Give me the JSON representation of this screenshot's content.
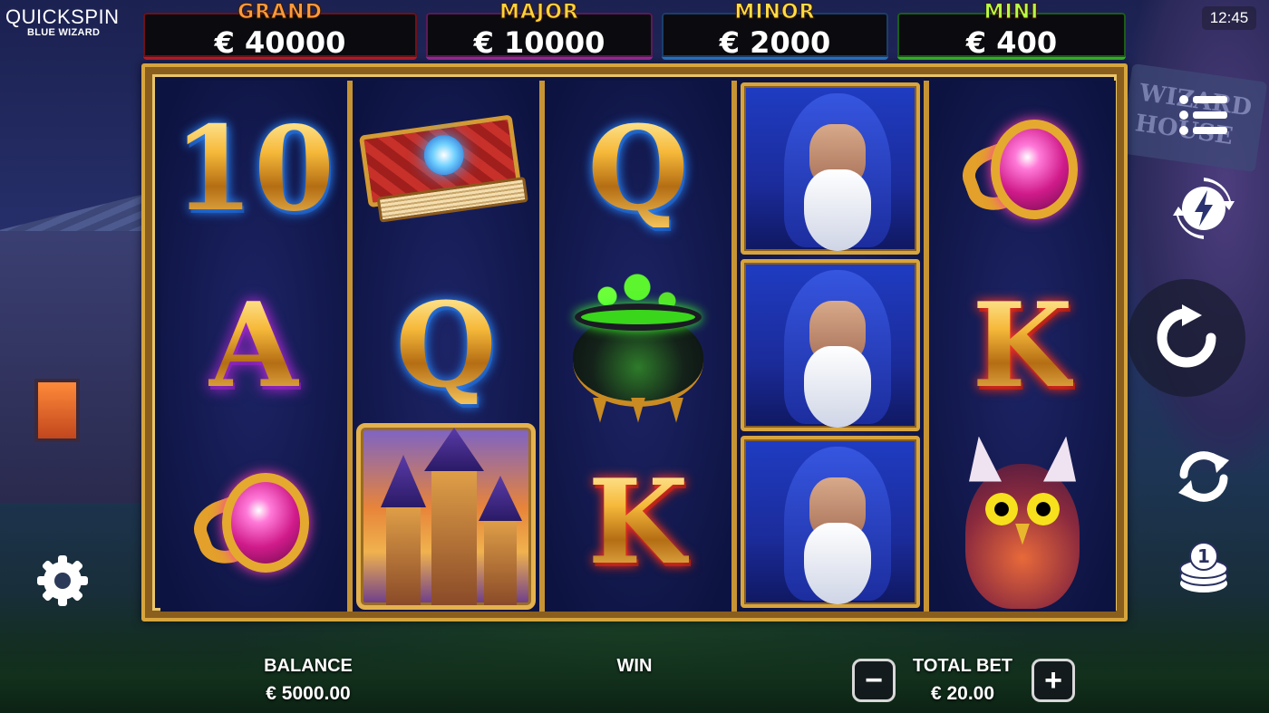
{
  "logo": {
    "brand": "QUICKSPIN",
    "game": "BLUE WIZARD"
  },
  "clock": "12:45",
  "jackpots": {
    "grand": {
      "name": "GRAND",
      "value": "€ 40000"
    },
    "major": {
      "name": "MAJOR",
      "value": "€ 10000"
    },
    "minor": {
      "name": "MINOR",
      "value": "€ 2000"
    },
    "mini": {
      "name": "MINI",
      "value": "€ 400"
    }
  },
  "reels": [
    [
      "10",
      "A",
      "ring"
    ],
    [
      "book",
      "Q",
      "castle"
    ],
    [
      "Q",
      "cauldron",
      "K"
    ],
    [
      "wizard",
      "wizard",
      "wizard"
    ],
    [
      "ring",
      "K",
      "owl"
    ]
  ],
  "letters": {
    "ten": "10",
    "ace": "A",
    "queen": "Q",
    "king": "K"
  },
  "background": {
    "sign_text": "WIZARD HOUSE"
  },
  "controls": {
    "menu_icon": "menu-list-icon",
    "turbo_icon": "lightning-turbo-icon",
    "spin_icon": "spin-arrow-icon",
    "autoplay_icon": "autoplay-arrows-icon",
    "coin_icon": "coin-stack-icon",
    "settings_icon": "gear-icon"
  },
  "bottom": {
    "balance_label": "BALANCE",
    "balance_value": "€ 5000.00",
    "win_label": "WIN",
    "total_bet_label": "TOTAL BET",
    "total_bet_value": "€ 20.00",
    "minus": "−",
    "plus": "+"
  },
  "colors": {
    "frame_gold": "#d7a53e",
    "grand": "#b81f2b",
    "major": "#a02c9a",
    "minor": "#2c78c8",
    "mini": "#39b82c"
  }
}
